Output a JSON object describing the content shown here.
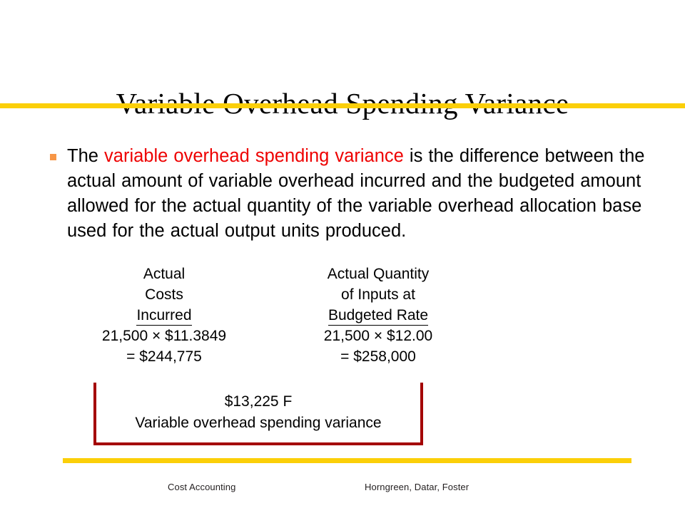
{
  "slide": {
    "title": "Variable Overhead Spending Variance",
    "accent_gold": "#fbcf09",
    "accent_red": "#ee0000",
    "box_border_color": "#a40000",
    "bullet_color": "#f79646"
  },
  "body": {
    "bullet": {
      "lead": "The ",
      "highlight": "variable overhead spending variance",
      "rest": " is  the difference between the actual amount of variable overhead incurred and the budgeted amount allowed for the actual quantity of the variable overhead  allocation  base used for the actual output units produced."
    }
  },
  "calculation": {
    "columns": [
      {
        "header_line1": "Actual",
        "header_line2": "Costs",
        "header_line3": "Incurred",
        "value_line1": "21,500 × $11.3849",
        "value_line2": "= $244,775"
      },
      {
        "header_line1": "Actual Quantity",
        "header_line2": "of Inputs at",
        "header_line3": "Budgeted Rate",
        "value_line1": "21,500 × $12.00",
        "value_line2": "= $258,000"
      }
    ]
  },
  "variance": {
    "amount": "$13,225 F",
    "label": "Variable overhead spending variance"
  },
  "footer": {
    "left": "Cost Accounting",
    "right": "Horngreen, Datar, Foster"
  }
}
